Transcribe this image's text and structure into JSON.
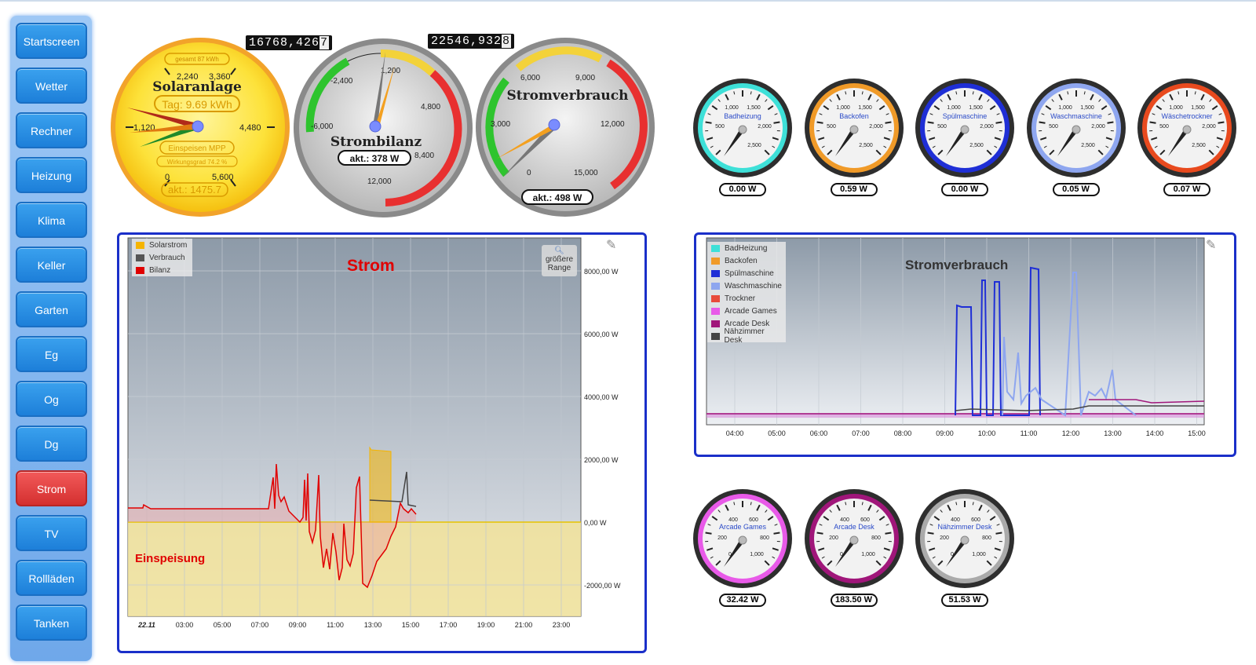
{
  "sidebar": {
    "items": [
      "Startscreen",
      "Wetter",
      "Rechner",
      "Heizung",
      "Klima",
      "Keller",
      "Garten",
      "Eg",
      "Og",
      "Dg",
      "Strom",
      "TV",
      "Rollläden",
      "Tanken"
    ],
    "active": "Strom"
  },
  "counters": {
    "solar": {
      "main": "16768,426",
      "last": "7"
    },
    "bilanz": {
      "main": "22546,932",
      "last": "8"
    }
  },
  "solar_gauge": {
    "title": "Solaranlage",
    "total": "gesamt 87 kWh",
    "tag": "Tag: 9.69 kWh",
    "mode": "Einspeisen MPP",
    "wirkungsgrad": "Wirkungsgrad 74.2 %",
    "akt": "akt.: 1475.7",
    "ticks": [
      "2,240",
      "3,360",
      "1,120",
      "4,480",
      "0",
      "5,600"
    ]
  },
  "bilanz_gauge": {
    "title": "Strombilanz",
    "akt": "akt.: 378 W",
    "ticks": [
      "-2,400",
      "1,200",
      "4,800",
      "-6,000",
      "8,400",
      "12,000"
    ]
  },
  "verbrauch_gauge": {
    "title": "Stromverbrauch",
    "akt": "akt.: 498 W",
    "ticks": [
      "6,000",
      "9,000",
      "3,000",
      "12,000",
      "0",
      "15,000"
    ]
  },
  "small_gauges": [
    {
      "label": "Badheizung",
      "value": "0.00 W",
      "ring": "#3ee0d8"
    },
    {
      "label": "Backofen",
      "value": "0.59 W",
      "ring": "#f09a28"
    },
    {
      "label": "Spülmaschine",
      "value": "0.00 W",
      "ring": "#1f2fd6"
    },
    {
      "label": "Waschmaschine",
      "value": "0.05 W",
      "ring": "#8ea6ef"
    },
    {
      "label": "Wäschetrockner",
      "value": "0.07 W",
      "ring": "#e84a1e"
    }
  ],
  "small_gauge_ticks": [
    "1,000",
    "1,500",
    "500",
    "2,000",
    "2,500"
  ],
  "small_gauges2": [
    {
      "label": "Arcade Games",
      "value": "32.42 W",
      "ring": "#e85ae8"
    },
    {
      "label": "Arcade Desk",
      "value": "183.50 W",
      "ring": "#a0167a"
    },
    {
      "label": "Nähzimmer Desk",
      "value": "51.53 W",
      "ring": "#aaaaaa"
    }
  ],
  "small_gauge2_ticks": [
    "400",
    "600",
    "200",
    "800",
    "0",
    "1,000"
  ],
  "strom_chart": {
    "title": "Strom",
    "einspeisung": "Einspeisung",
    "range_button": "größere Range",
    "legend": [
      "Solarstrom",
      "Verbrauch",
      "Bilanz"
    ],
    "legend_colors": [
      "#f5b400",
      "#555555",
      "#e00000"
    ],
    "y_ticks": [
      "8000,00 W",
      "6000,00 W",
      "4000,00 W",
      "2000,00 W",
      "0,00 W",
      "-2000,00 W"
    ],
    "x_ticks": [
      "22.11",
      "03:00",
      "05:00",
      "07:00",
      "09:00",
      "11:00",
      "13:00",
      "15:00",
      "17:00",
      "19:00",
      "21:00",
      "23:00"
    ]
  },
  "verbrauch_chart": {
    "title": "Stromverbrauch",
    "legend": [
      "BadHeizung",
      "Backofen",
      "Spülmaschine",
      "Waschmaschine",
      "Trockner",
      "Arcade Games",
      "Arcade Desk",
      "Nähzimmer Desk"
    ],
    "legend_colors": [
      "#3ee0d8",
      "#f09a28",
      "#1f2fd6",
      "#8ea6ef",
      "#e84a3a",
      "#e85ae8",
      "#a0167a",
      "#444444"
    ],
    "x_ticks": [
      "04:00",
      "05:00",
      "06:00",
      "07:00",
      "08:00",
      "09:00",
      "10:00",
      "11:00",
      "12:00",
      "13:00",
      "14:00",
      "15:00"
    ]
  }
}
